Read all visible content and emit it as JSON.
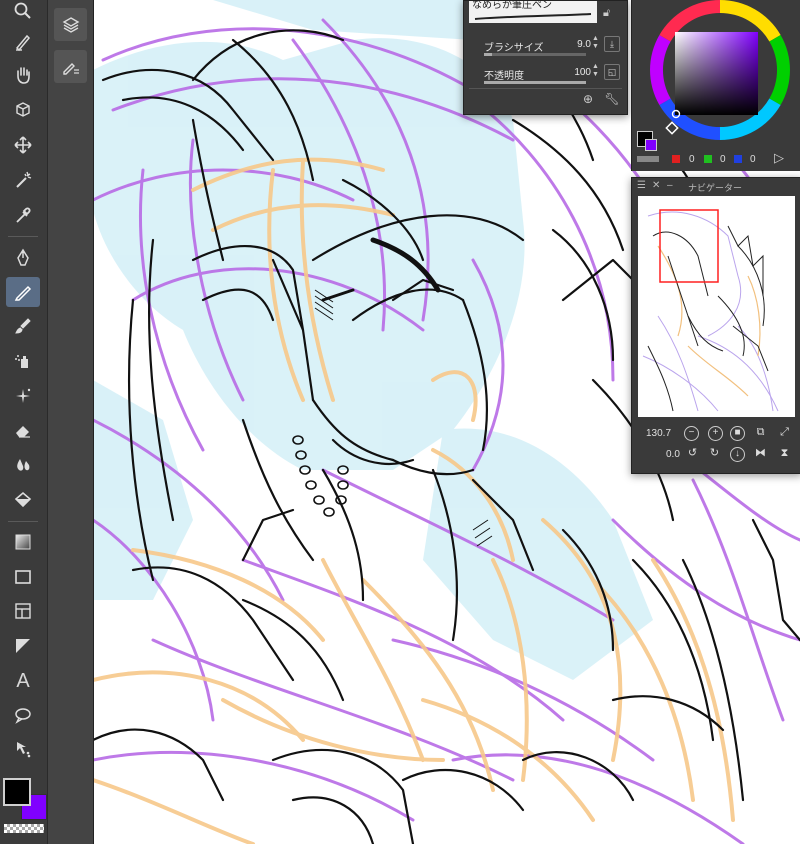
{
  "tool_property": {
    "brush_name": "なめらか筆圧ペン",
    "brush_size_label": "ブラシサイズ",
    "brush_size_value": "9.0",
    "opacity_label": "不透明度",
    "opacity_value": "100"
  },
  "navigator": {
    "title": "ナビゲーター",
    "zoom": "130.7",
    "rotation": "0.0"
  },
  "color": {
    "foreground": "#000000",
    "background": "#8000ff",
    "rgb_values": [
      "0",
      "0",
      "0"
    ]
  },
  "toolbar": {
    "tools": [
      "zoom-icon",
      "pen-nib-small-icon",
      "hand-icon",
      "object-select-icon",
      "move-icon",
      "magic-wand-icon",
      "eyedropper-icon",
      "pen-icon",
      "pencil-icon",
      "brush-icon",
      "airbrush-icon",
      "sparkle-decoration-icon",
      "eraser-icon",
      "blend-drop-icon",
      "fill-bucket-icon",
      "gradient-icon",
      "rectangle-icon",
      "frame-border-icon",
      "ruler-icon",
      "text-icon",
      "balloon-icon",
      "correct-line-icon"
    ],
    "text_tool_glyph": "A"
  }
}
